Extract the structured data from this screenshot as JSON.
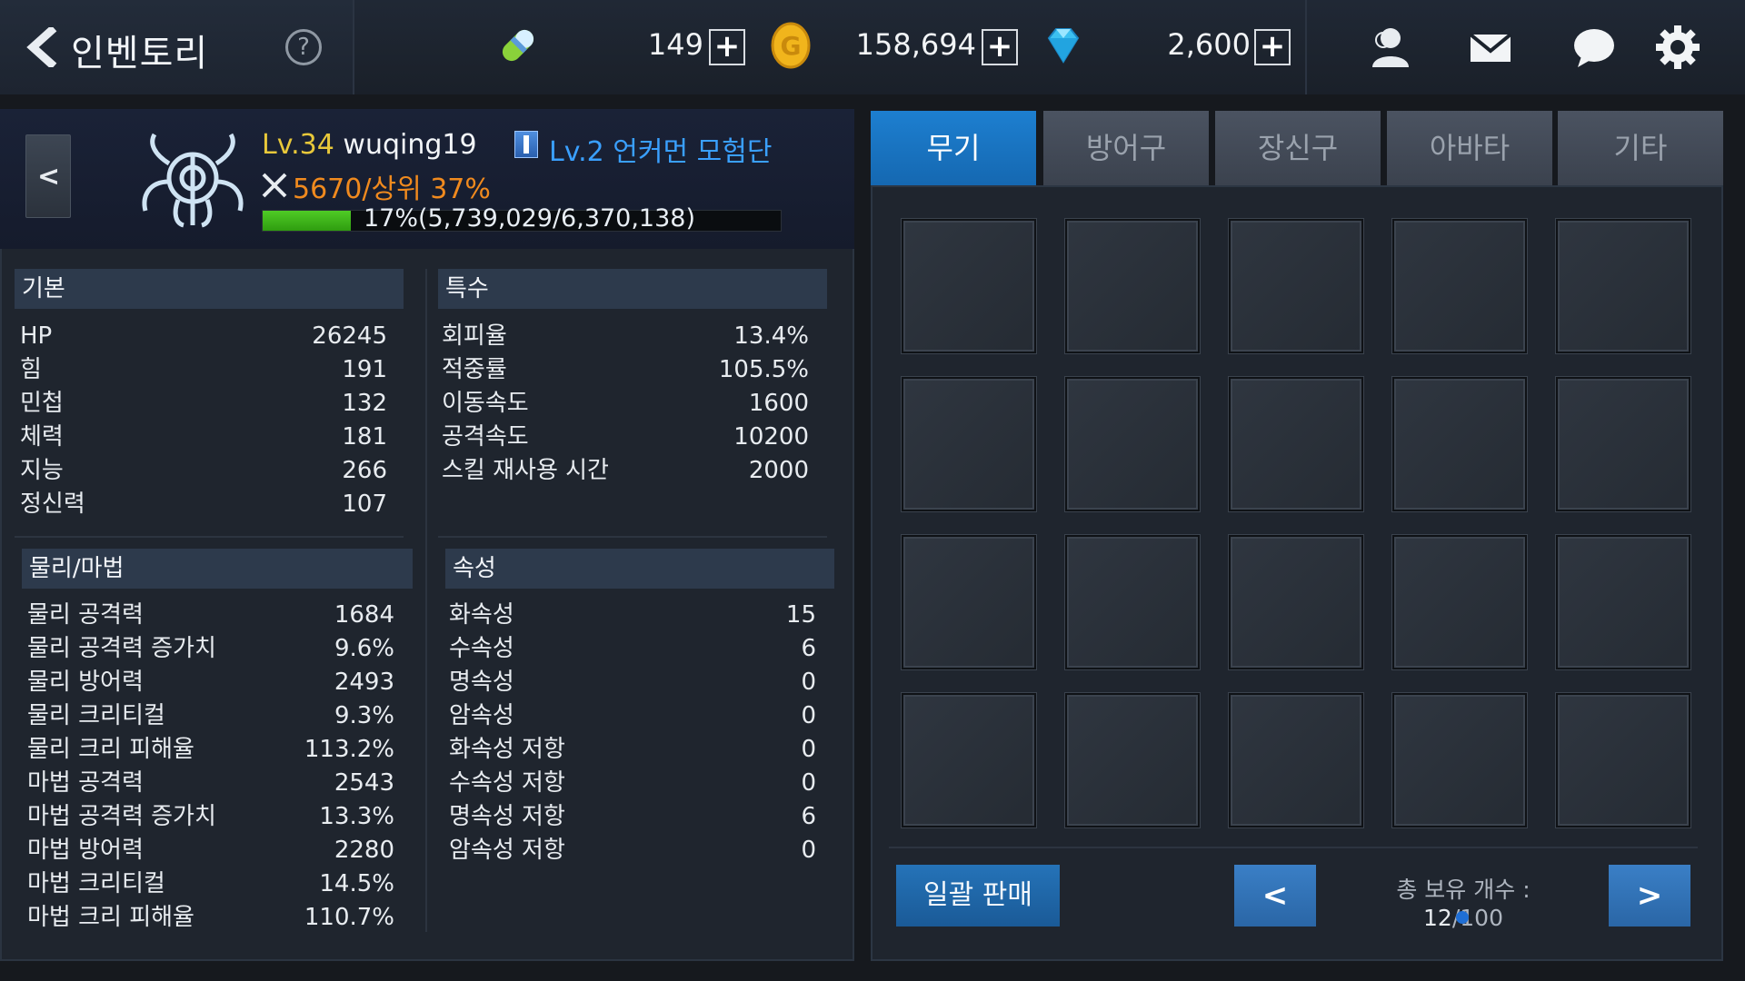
{
  "header": {
    "title": "인벤토리",
    "help_label": "?",
    "currencies": [
      {
        "icon": "energy-capsule-icon",
        "value": "149",
        "plus": "+"
      },
      {
        "icon": "gold-coin-icon",
        "value": "158,694",
        "plus": "+"
      },
      {
        "icon": "diamond-icon",
        "value": "2,600",
        "plus": "+"
      }
    ],
    "right_icons": [
      "friends-icon",
      "mail-icon",
      "chat-icon",
      "settings-icon"
    ]
  },
  "character": {
    "level": "Lv.34",
    "name": "wuqing19",
    "guild": "Lv.2 언커먼 모험단",
    "power": "5670/",
    "rank": "상위 37%",
    "exp_text": "17%(5,739,029/6,370,138)",
    "exp_fraction": 0.17
  },
  "stats": {
    "basic": {
      "title": "기본",
      "rows": [
        {
          "label": "HP",
          "value": "26245"
        },
        {
          "label": "힘",
          "value": "191"
        },
        {
          "label": "민첩",
          "value": "132"
        },
        {
          "label": "체력",
          "value": "181"
        },
        {
          "label": "지능",
          "value": "266"
        },
        {
          "label": "정신력",
          "value": "107"
        }
      ]
    },
    "special": {
      "title": "특수",
      "rows": [
        {
          "label": "회피율",
          "value": "13.4%"
        },
        {
          "label": "적중률",
          "value": "105.5%"
        },
        {
          "label": "이동속도",
          "value": "1600"
        },
        {
          "label": "공격속도",
          "value": "10200"
        },
        {
          "label": "스킬 재사용 시간",
          "value": "2000"
        }
      ]
    },
    "physmag": {
      "title": "물리/마법",
      "rows": [
        {
          "label": "물리 공격력",
          "value": "1684"
        },
        {
          "label": "물리 공격력 증가치",
          "value": "9.6%"
        },
        {
          "label": "물리 방어력",
          "value": "2493"
        },
        {
          "label": "물리 크리티컬",
          "value": "9.3%"
        },
        {
          "label": "물리 크리 피해율",
          "value": "113.2%"
        },
        {
          "label": "마법 공격력",
          "value": "2543"
        },
        {
          "label": "마법 공격력 증가치",
          "value": "13.3%"
        },
        {
          "label": "마법 방어력",
          "value": "2280"
        },
        {
          "label": "마법 크리티컬",
          "value": "14.5%"
        },
        {
          "label": "마법 크리 피해율",
          "value": "110.7%"
        }
      ]
    },
    "element": {
      "title": "속성",
      "rows": [
        {
          "label": "화속성",
          "value": "15"
        },
        {
          "label": "수속성",
          "value": "6"
        },
        {
          "label": "명속성",
          "value": "0"
        },
        {
          "label": "암속성",
          "value": "0"
        },
        {
          "label": "화속성 저항",
          "value": "0"
        },
        {
          "label": "수속성 저항",
          "value": "0"
        },
        {
          "label": "명속성 저항",
          "value": "6"
        },
        {
          "label": "암속성 저항",
          "value": "0"
        }
      ]
    }
  },
  "inventory": {
    "tabs": [
      {
        "label": "무기",
        "active": true
      },
      {
        "label": "방어구",
        "active": false
      },
      {
        "label": "장신구",
        "active": false
      },
      {
        "label": "아바타",
        "active": false
      },
      {
        "label": "기타",
        "active": false
      }
    ],
    "bulk_sell_label": "일괄 판매",
    "count_label": "총 보유 개수 : ",
    "count_value": "12",
    "count_max": "/100",
    "prev_label": "<",
    "next_label": ">"
  },
  "colors": {
    "accent_blue": "#1d7fd0",
    "level_yellow": "#e8c83a",
    "guild_blue": "#3aa0ff",
    "power_orange": "#f08a1e",
    "exp_green": "#4fcb26"
  }
}
